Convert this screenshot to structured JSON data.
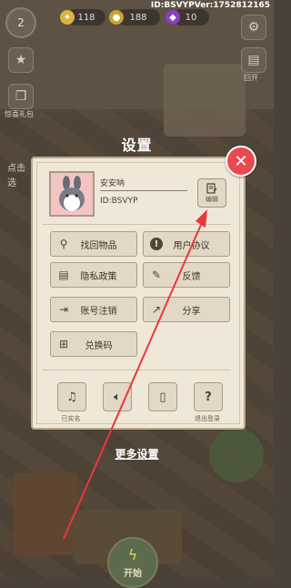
{
  "topbar": {
    "level": "2",
    "resource1": "118",
    "resource2": "188",
    "resource3": "10",
    "version": "ID:BSVYPVer:1752812165"
  },
  "sidebar": {
    "gift_label": "惊喜礼包",
    "side_text_1": "点击",
    "side_text_2": "选",
    "right_label": "回开"
  },
  "dialog": {
    "title": "设置",
    "close_icon": "close-icon",
    "profile": {
      "username": "安安呐",
      "user_id": "ID:BSVYP",
      "edit_label": "编辑"
    },
    "menu": [
      {
        "label": "找回物品",
        "icon": "magnifier-icon"
      },
      {
        "label": "用户协议",
        "icon": "alert-icon"
      },
      {
        "label": "隐私政策",
        "icon": "document-icon"
      },
      {
        "label": "反馈",
        "icon": "pencil-icon"
      },
      {
        "label": "账号注销",
        "icon": "logout-icon"
      },
      {
        "label": "分享",
        "icon": "share-icon"
      },
      {
        "label": "兑换码",
        "icon": "gift-icon"
      }
    ],
    "small_buttons": [
      {
        "label": "已实名",
        "icon": "music-icon"
      },
      {
        "label": "",
        "icon": "speaker-icon"
      },
      {
        "label": "",
        "icon": "vibrate-icon"
      },
      {
        "label": "退出登录",
        "icon": "question-icon"
      }
    ],
    "more_settings": "更多设置"
  },
  "bottom": {
    "start_label": "开始"
  },
  "colors": {
    "close_red": "#e94a4f",
    "panel_bg": "#efe7d7",
    "arrow_red": "#e8393b"
  }
}
